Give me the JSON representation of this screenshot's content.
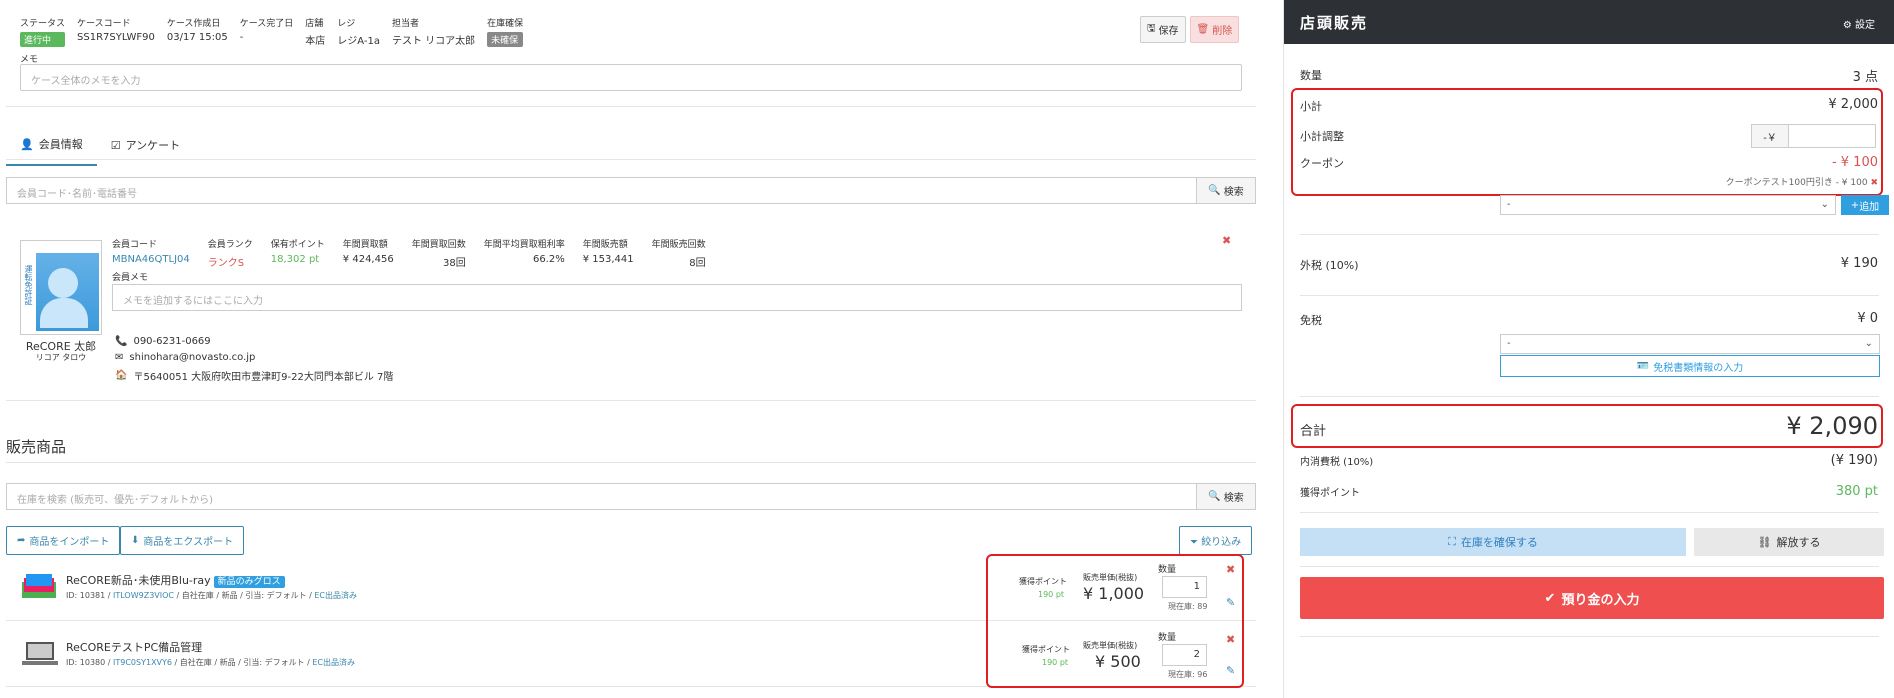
{
  "header": {
    "fields": [
      {
        "label": "ステータス",
        "value": "進行中"
      },
      {
        "label": "ケースコード",
        "value": "SS1R7SYLWF90"
      },
      {
        "label": "ケース作成日",
        "value": "03/17 15:05"
      },
      {
        "label": "ケース完了日",
        "value": "-"
      },
      {
        "label": "店舗",
        "value": "本店"
      },
      {
        "label": "レジ",
        "value": "レジA-1a"
      },
      {
        "label": "担当者",
        "value": "テスト リコア太郎"
      },
      {
        "label": "在庫確保",
        "value": "未確保"
      }
    ],
    "save_label": "保存",
    "delete_label": "削除",
    "memo_label": "メモ",
    "memo_placeholder": "ケース全体のメモを入力"
  },
  "tabs": [
    {
      "label": "会員情報"
    },
    {
      "label": "アンケート"
    }
  ],
  "member_search": {
    "placeholder": "会員コード･名前･電話番号",
    "button": "検索"
  },
  "member": {
    "name": "ReCORE 太郎",
    "kana": "リコア タロウ",
    "card_side_text": "運転免許証",
    "stats": [
      {
        "label": "会員コード",
        "value": "MBNA46QTLJ04"
      },
      {
        "label": "会員ランク",
        "value": "ランクS"
      },
      {
        "label": "保有ポイント",
        "value": "18,302 pt"
      },
      {
        "label": "年間買取額",
        "value": "¥ 424,456"
      },
      {
        "label": "年間買取回数",
        "value": "38回"
      },
      {
        "label": "年間平均買取粗利率",
        "value": "66.2%"
      },
      {
        "label": "年間販売額",
        "value": "¥ 153,441"
      },
      {
        "label": "年間販売回数",
        "value": "8回"
      }
    ],
    "memo_label": "会員メモ",
    "memo_placeholder": "メモを追加するにはここに入力",
    "phone": "090-6231-0669",
    "email": "shinohara@novasto.co.jp",
    "address": "〒5640051 大阪府吹田市豊津町9-22大同門本部ビル 7階"
  },
  "sales": {
    "title": "販売商品",
    "search_placeholder": "在庫を検索 (販売可、優先･デフォルトから)",
    "search_button": "検索",
    "import_label": "商品をインポート",
    "export_label": "商品をエクスポート",
    "filter_label": "絞り込み",
    "items": [
      {
        "name": "ReCORE新品･未使用Blu-ray",
        "tag": "新品のみグロス",
        "id_text": "ID: 10381 /",
        "code": "ITLOW9Z3VIOC",
        "meta": "/ 自社在庫 / 新品 / 引当: デフォルト /",
        "ec": "EC出品済み",
        "point_label": "獲得ポイント",
        "point": "190 pt",
        "price_label": "販売単価(税抜)",
        "price": "¥ 1,000",
        "qty_label": "数量",
        "qty": "1",
        "stock": "現在庫: 89"
      },
      {
        "name": "ReCOREテストPC備品管理",
        "tag": "",
        "id_text": "ID: 10380 /",
        "code": "IT9C0SY1XVY6",
        "meta": "/ 自社在庫 / 新品 / 引当: デフォルト /",
        "ec": "EC出品済み",
        "point_label": "獲得ポイント",
        "point": "190 pt",
        "price_label": "販売単価(税抜)",
        "price": "¥ 500",
        "qty_label": "数量",
        "qty": "2",
        "stock": "現在庫: 96"
      }
    ]
  },
  "register": {
    "title": "店頭販売",
    "settings_label": "設定",
    "qty_label": "数量",
    "qty_value": "3 点",
    "subtotal_label": "小計",
    "subtotal_value": "¥ 2,000",
    "adjust_label": "小計調整",
    "adjust_prefix": "-￥",
    "coupon_label": "クーポン",
    "coupon_value": "- ¥ 100",
    "coupon_note": "クーポンテスト100円引き - ¥ 100",
    "coupon_select": "-",
    "add_label": "追加",
    "tax_out_label": "外税 (10%)",
    "tax_out_value": "¥ 190",
    "tax_free_label": "免税",
    "tax_free_value": "¥ 0",
    "tax_free_select": "-",
    "tax_doc_label": "免税書類情報の入力",
    "total_label": "合計",
    "total_value": "¥ 2,090",
    "tax_in_label": "内消費税 (10%)",
    "tax_in_value": "(¥ 190)",
    "points_label": "獲得ポイント",
    "points_value": "380 pt",
    "reserve_label": "在庫を確保する",
    "release_label": "解放する",
    "deposit_label": "預り金の入力"
  },
  "colors": {
    "accent": "#3a87ad",
    "danger": "#d9534f",
    "success": "#5cb85c",
    "highlight": "#e02020",
    "header_bg": "#2d3035"
  }
}
